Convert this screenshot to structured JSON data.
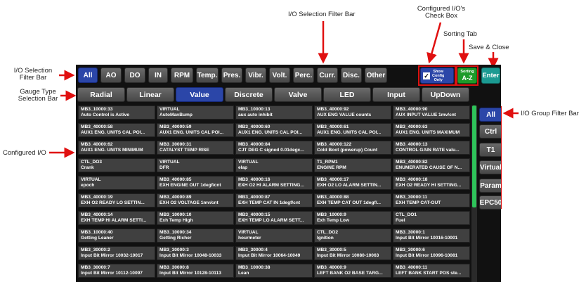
{
  "annotations": {
    "io_filter_top": "I/O Selection Filter Bar",
    "configured_check": [
      "Configured I/O's",
      "Check Box"
    ],
    "sorting_tab": "Sorting Tab",
    "save_close": "Save & Close",
    "io_filter_left": [
      "I/O Selection",
      "Filter Bar"
    ],
    "gauge_type": [
      "Gauge Type",
      "Selection Bar"
    ],
    "configured_io": "Configured I/O",
    "group_filter": "I/O Group Filter Bar"
  },
  "filter_bar": [
    "All",
    "AO",
    "DO",
    "IN",
    "RPM",
    "Temp.",
    "Pres.",
    "Vibr.",
    "Volt.",
    "Perc.",
    "Curr.",
    "Disc.",
    "Other"
  ],
  "show_config": [
    "Show",
    "Config",
    "Only"
  ],
  "sorting": [
    "Sorting",
    "A-Z"
  ],
  "enter": "Enter",
  "gauge_types": [
    "Radial",
    "Linear",
    "Value",
    "Discrete",
    "Valve",
    "LED",
    "Input",
    "UpDown"
  ],
  "group_filters": [
    "All",
    "Ctrl",
    "T1",
    "Virtual",
    "Param",
    "EPC50"
  ],
  "io_rows": [
    [
      [
        "MB3_10000:33",
        "Auto Control is Active"
      ],
      [
        "VIRTUAL",
        "AutoManBump"
      ],
      [
        "MB3_10000:13",
        "aux auto inhibit"
      ],
      [
        "MB3_40000:92",
        "AUX ENG VALUE counts"
      ],
      [
        "MB3_40000:90",
        "AUX INPUT VALUE 1mv/cnt"
      ]
    ],
    [
      [
        "MB3_40000:58",
        "AUX1 ENG. UNITS CAL POI..."
      ],
      [
        "MB3_40000:59",
        "AUX1 ENG. UNITS CAL POI..."
      ],
      [
        "MB3_40000:60",
        "AUX1 ENG. UNITS CAL POI..."
      ],
      [
        "MB3_40000:61",
        "AUX1 ENG. UNITS CAL POI..."
      ],
      [
        "MB3_40000:63",
        "AUX1 ENG. UNITS MAXIMUM"
      ]
    ],
    [
      [
        "MB3_40000:62",
        "AUX1 ENG. UNITS MINIMUM"
      ],
      [
        "MB3_30000:31",
        "CATALYST TEMP RISE"
      ],
      [
        "MB3_40000:84",
        "CJT DEG C signed 0.01degc..."
      ],
      [
        "MB3_40000:122",
        "Cold Boot (powerup) Count"
      ],
      [
        "MB3_40000:13",
        "CONTROL GAIN RATE valu..."
      ]
    ],
    [
      [
        "CTL_DO3",
        "Crank"
      ],
      [
        "VIRTUAL",
        "DFR"
      ],
      [
        "VIRTUAL",
        "elap"
      ],
      [
        "T1_RPM1",
        "ENGINE RPM"
      ],
      [
        "MB3_40000:82",
        "ENUMERATED CAUSE OF N..."
      ]
    ],
    [
      [
        "VIRTUAL",
        "epoch"
      ],
      [
        "MB3_40000:85",
        "EXH ENGINE OUT 1degf/cnt"
      ],
      [
        "MB3_40000:16",
        "EXH O2 HI ALARM SETTING..."
      ],
      [
        "MB3_40000:17",
        "EXH O2 LO ALARM SETTIN..."
      ],
      [
        "MB3_40000:18",
        "EXH O2 READY HI SETTING..."
      ]
    ],
    [
      [
        "MB3_40000:19",
        "EXH O2 READY LO SETTIN..."
      ],
      [
        "MB3_40000:89",
        "EXH O2 VOLTAGE 1mv/cnt"
      ],
      [
        "MB3_40000:87",
        "EXH TEMP CAT IN 1degf/cnt"
      ],
      [
        "MB3_40000:88",
        "EXH TEMP CAT OUT 1degf/..."
      ],
      [
        "MB3_30000:11",
        "EXH TEMP CAT-OUT"
      ]
    ],
    [
      [
        "MB3_40000:14",
        "EXH TEMP HI ALARM SETTI..."
      ],
      [
        "MB3_10000:10",
        "Exh Temp High"
      ],
      [
        "MB3_40000:15",
        "EXH TEMP LO ALARM SETT..."
      ],
      [
        "MB3_10000:9",
        "Exh Temp Low"
      ],
      [
        "CTL_DO1",
        "Fuel"
      ]
    ],
    [
      [
        "MB3_10000:40",
        "Getting Leaner"
      ],
      [
        "MB3_10000:34",
        "Getting Richer"
      ],
      [
        "VIRTUAL",
        "hourmeter"
      ],
      [
        "CTL_DO2",
        "Ignition"
      ],
      [
        "MB3_30000:1",
        "Input Bit Mirror 10016-10001"
      ]
    ],
    [
      [
        "MB3_30000:2",
        "Input Bit Mirror 10032-10017"
      ],
      [
        "MB3_30000:3",
        "Input Bit Mirror 10048-10033"
      ],
      [
        "MB3_30000:4",
        "Input Bit Mirror 10064-10049"
      ],
      [
        "MB3_30000:5",
        "Input Bit Mirror 10080-10063"
      ],
      [
        "MB3_30000:6",
        "Input Bit Mirror 10096-10081"
      ]
    ],
    [
      [
        "MB3_30000:7",
        "Input Bit Mirror 10112-10097"
      ],
      [
        "MB3_30000:8",
        "Input Bit Mirror 10128-10113"
      ],
      [
        "MB3_10000:38",
        "Lean"
      ],
      [
        "MB3_40000:9",
        "LEFT BANK O2 BASE TARG..."
      ],
      [
        "MB3_40000:11",
        "LEFT BANK START POS ste..."
      ]
    ]
  ]
}
